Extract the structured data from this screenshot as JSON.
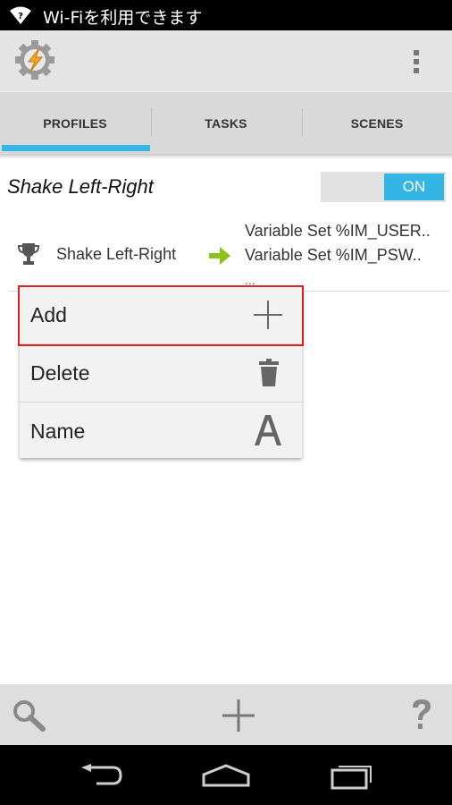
{
  "status_bar": {
    "text": "Wi-Fiを利用できます",
    "icon": "wifi-question-icon"
  },
  "action_bar": {
    "app_icon": "tasker-gear-bolt-icon",
    "overflow_icon": "overflow-menu-icon"
  },
  "tabs": [
    {
      "label": "PROFILES",
      "selected": true
    },
    {
      "label": "TASKS",
      "selected": false
    },
    {
      "label": "SCENES",
      "selected": false
    }
  ],
  "profile": {
    "title": "Shake Left-Right",
    "toggle_label": "ON",
    "context": {
      "icon": "trophy-icon",
      "label": "Shake Left-Right"
    },
    "arrow_icon": "arrow-right-icon",
    "tasks": [
      "Variable Set %IM_USER..",
      "Variable Set %IM_PSW.."
    ],
    "more_indicator": "..."
  },
  "context_menu": {
    "items": [
      {
        "label": "Add",
        "icon": "plus-icon"
      },
      {
        "label": "Delete",
        "icon": "trash-icon"
      },
      {
        "label": "Name",
        "icon": "letter-a-icon"
      }
    ]
  },
  "bottom_bar": {
    "icons": [
      "search-icon",
      "add-icon",
      "help-icon"
    ]
  },
  "nav_bar": {
    "icons": [
      "back-icon",
      "home-icon",
      "recents-icon"
    ]
  },
  "colors": {
    "accent": "#33b5e5",
    "highlight": "#e02020",
    "arrow": "#8cc21b"
  }
}
